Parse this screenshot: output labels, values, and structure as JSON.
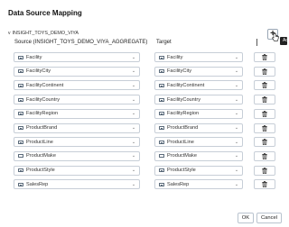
{
  "dialog": {
    "title": "Data Source Mapping"
  },
  "section": {
    "label": "INSIGHT_TOYS_DEMO_VIYA",
    "chevron": "v"
  },
  "add_button": {
    "label": "+",
    "tooltip": "Add"
  },
  "columns": {
    "source": "Source (INSIGHT_TOYS_DEMO_VIYA_AGGREGATE)",
    "target": "Target"
  },
  "icons": {
    "select": "table-column-icon",
    "delete": "trash-icon",
    "dropdown": "chevron-down-icon"
  },
  "mappings": [
    {
      "source": "Facility",
      "target": "Facility"
    },
    {
      "source": "FacilityCity",
      "target": "FacilityCity"
    },
    {
      "source": "FacilityContinent",
      "target": "FacilityContinent"
    },
    {
      "source": "FacilityCountry",
      "target": "FacilityCountry"
    },
    {
      "source": "FacilityRegion",
      "target": "FacilityRegion"
    },
    {
      "source": "ProductBrand",
      "target": "ProductBrand"
    },
    {
      "source": "ProductLine",
      "target": "ProductLine"
    },
    {
      "source": "ProductMake",
      "target": "ProductMake"
    },
    {
      "source": "ProductStyle",
      "target": "ProductStyle"
    },
    {
      "source": "SalesRep",
      "target": "SalesRep"
    }
  ],
  "footer": {
    "ok_label": "OK",
    "cancel_label": "Cancel"
  }
}
